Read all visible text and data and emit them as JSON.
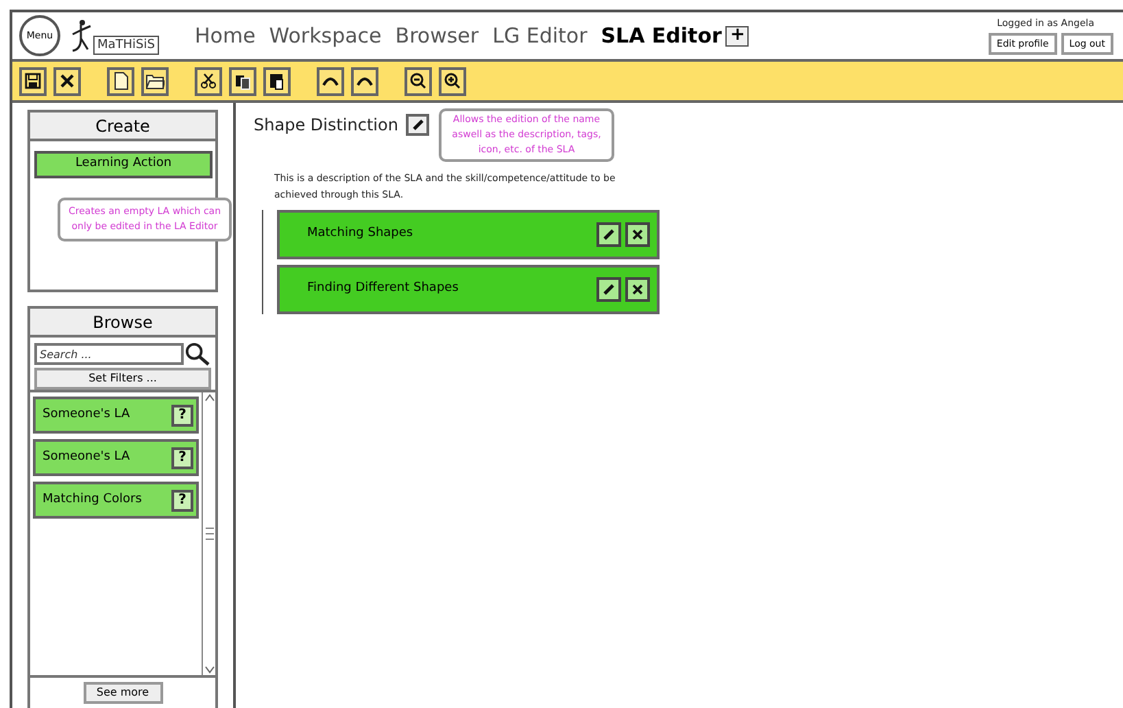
{
  "header": {
    "menu_button": "Menu",
    "logo": "MaTHiSiS",
    "tabs": [
      {
        "label": "Home",
        "selected": false
      },
      {
        "label": "Workspace",
        "selected": false
      },
      {
        "label": "Browser",
        "selected": false
      },
      {
        "label": "LG Editor",
        "selected": false
      },
      {
        "label": "SLA Editor",
        "selected": true
      }
    ],
    "add_tab": "+",
    "user_status": "Logged in as Angela",
    "buttons": [
      "Edit profile",
      "Log out"
    ]
  },
  "create_panel": {
    "title": "Create",
    "button": "Learning Action",
    "tooltip": "Creates an empty LA which can only be edited in the LA Editor"
  },
  "browse_panel": {
    "title": "Browse",
    "search": {
      "placeholder": "Search ..."
    },
    "filter_button": "Set Filters ...",
    "items": [
      {
        "label": "Someone's LA",
        "help": "?"
      },
      {
        "label": "Someone's LA",
        "help": "?"
      },
      {
        "label": "Matching Colors",
        "help": "?"
      }
    ],
    "see_more": "See more"
  },
  "sla": {
    "title": "Shape Distinction",
    "tooltip": "Allows the edition of the name aswell as the description, tags, icon, etc. of the SLA",
    "description": "This is a description of the SLA and the skill/competence/attitude to be achieved through this SLA.",
    "items": [
      {
        "label": "Matching Shapes"
      },
      {
        "label": "Finding Different Shapes"
      }
    ]
  }
}
